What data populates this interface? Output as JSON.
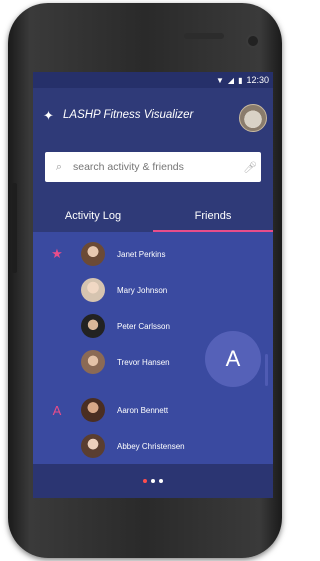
{
  "status_bar": {
    "time": "12:30",
    "icons": [
      "wifi-icon",
      "signal-icon",
      "battery-icon"
    ]
  },
  "app": {
    "title": "LASHP Fitness Visualizer"
  },
  "search": {
    "placeholder": "search activity & friends"
  },
  "tabs": [
    {
      "label": "Activity Log",
      "active": false
    },
    {
      "label": "Friends",
      "active": true
    }
  ],
  "friends": [
    {
      "name": "Janet Perkins",
      "lead": "★"
    },
    {
      "name": "Mary Johnson",
      "lead": ""
    },
    {
      "name": "Peter Carlsson",
      "lead": ""
    },
    {
      "name": "Trevor Hansen",
      "lead": ""
    },
    {
      "name": "Aaron Bennett",
      "lead": "A"
    },
    {
      "name": "Abbey Christensen",
      "lead": ""
    }
  ],
  "fab": {
    "label": "A"
  },
  "pager": {
    "count": 3,
    "active_index": 0
  },
  "colors": {
    "screen_bg": "#2f3a78",
    "list_bg": "#3a4aa0",
    "accent": "#e84d8a",
    "fab": "#5561b8"
  }
}
